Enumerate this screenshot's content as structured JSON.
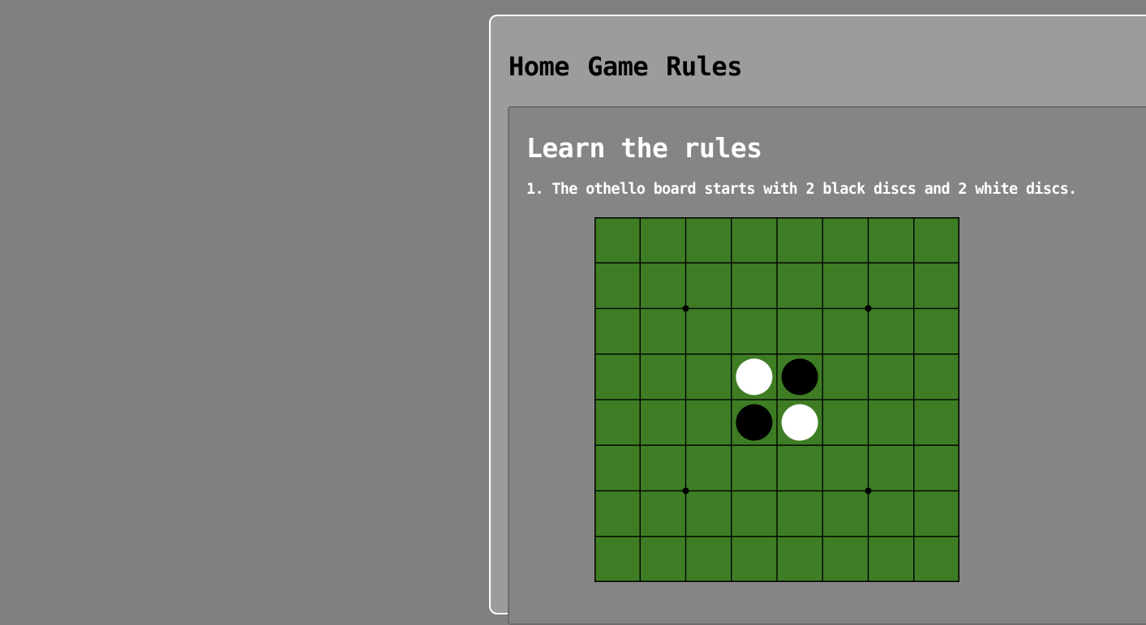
{
  "nav": {
    "items": [
      {
        "label": "Home"
      },
      {
        "label": "Game"
      },
      {
        "label": "Rules"
      }
    ]
  },
  "rules": {
    "heading": "Learn the rules",
    "step1": "1. The othello board starts with 2 black discs and 2 white discs."
  },
  "board": {
    "size": 8,
    "board_color": "#3e7d24",
    "line_color": "#000000",
    "star_points": [
      [
        2,
        2
      ],
      [
        2,
        6
      ],
      [
        6,
        2
      ],
      [
        6,
        6
      ]
    ],
    "discs": [
      {
        "row": 3,
        "col": 3,
        "color": "white"
      },
      {
        "row": 3,
        "col": 4,
        "color": "black"
      },
      {
        "row": 4,
        "col": 3,
        "color": "black"
      },
      {
        "row": 4,
        "col": 4,
        "color": "white"
      }
    ]
  }
}
